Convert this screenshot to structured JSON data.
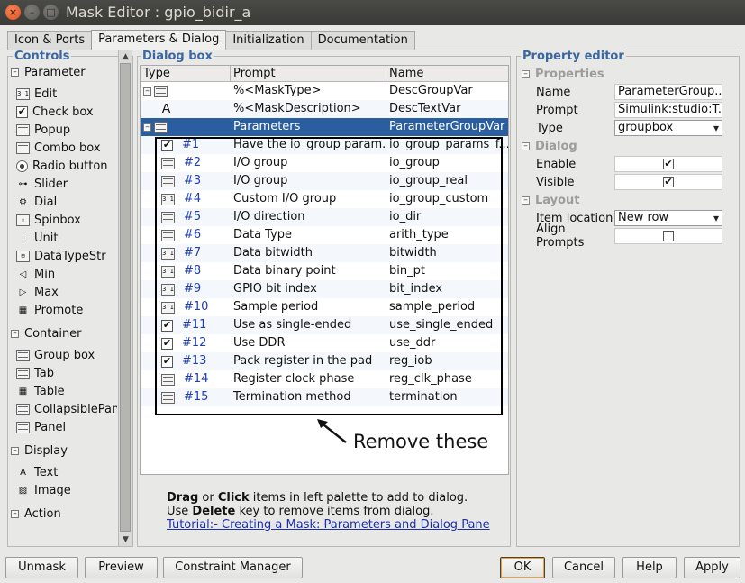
{
  "window": {
    "title": "Mask Editor : gpio_bidir_a"
  },
  "tabs": [
    "Icon & Ports",
    "Parameters & Dialog",
    "Initialization",
    "Documentation"
  ],
  "controls": {
    "title": "Controls",
    "groups": [
      {
        "label": "Parameter",
        "items": [
          {
            "label": "Edit",
            "icon": "edit-icon"
          },
          {
            "label": "Check box",
            "icon": "checkbox-icon"
          },
          {
            "label": "Popup",
            "icon": "popup-icon"
          },
          {
            "label": "Combo box",
            "icon": "combobox-icon"
          },
          {
            "label": "Radio button",
            "icon": "radio-icon"
          },
          {
            "label": "Slider",
            "icon": "slider-icon"
          },
          {
            "label": "Dial",
            "icon": "dial-icon"
          },
          {
            "label": "Spinbox",
            "icon": "spinbox-icon"
          },
          {
            "label": "Unit",
            "icon": "unit-icon"
          },
          {
            "label": "DataTypeStr",
            "icon": "datatype-icon"
          },
          {
            "label": "Min",
            "icon": "min-icon"
          },
          {
            "label": "Max",
            "icon": "max-icon"
          },
          {
            "label": "Promote",
            "icon": "promote-icon"
          }
        ]
      },
      {
        "label": "Container",
        "items": [
          {
            "label": "Group box",
            "icon": "groupbox-icon"
          },
          {
            "label": "Tab",
            "icon": "tab-icon"
          },
          {
            "label": "Table",
            "icon": "table-icon"
          },
          {
            "label": "CollapsiblePanel",
            "icon": "collapsible-icon"
          },
          {
            "label": "Panel",
            "icon": "panel-icon"
          }
        ]
      },
      {
        "label": "Display",
        "items": [
          {
            "label": "Text",
            "icon": "text-icon"
          },
          {
            "label": "Image",
            "icon": "image-icon"
          }
        ]
      },
      {
        "label": "Action",
        "items": []
      }
    ]
  },
  "dialog": {
    "title": "Dialog box",
    "columns": [
      "Type",
      "Prompt",
      "Name"
    ],
    "top_rows": [
      {
        "num": "",
        "prompt": "%<MaskType>",
        "name": "DescGroupVar",
        "kind": "group-root"
      },
      {
        "num": "",
        "prompt": "%<MaskDescription>",
        "name": "DescTextVar",
        "kind": "text"
      },
      {
        "num": "",
        "prompt": "Parameters",
        "name": "ParameterGroupVar",
        "kind": "group-sel"
      }
    ],
    "rows": [
      {
        "num": "#1",
        "prompt": "Have the io_group param...",
        "name": "io_group_params_f...",
        "kind": "checkbox"
      },
      {
        "num": "#2",
        "prompt": "I/O group",
        "name": "io_group",
        "kind": "popup"
      },
      {
        "num": "#3",
        "prompt": "I/O group",
        "name": "io_group_real",
        "kind": "popup"
      },
      {
        "num": "#4",
        "prompt": "Custom I/O group",
        "name": "io_group_custom",
        "kind": "edit"
      },
      {
        "num": "#5",
        "prompt": "I/O direction",
        "name": "io_dir",
        "kind": "popup"
      },
      {
        "num": "#6",
        "prompt": "Data Type",
        "name": "arith_type",
        "kind": "popup"
      },
      {
        "num": "#7",
        "prompt": "Data bitwidth",
        "name": "bitwidth",
        "kind": "edit"
      },
      {
        "num": "#8",
        "prompt": "Data binary point",
        "name": "bin_pt",
        "kind": "edit"
      },
      {
        "num": "#9",
        "prompt": "GPIO bit index",
        "name": "bit_index",
        "kind": "edit"
      },
      {
        "num": "#10",
        "prompt": "Sample period",
        "name": "sample_period",
        "kind": "edit"
      },
      {
        "num": "#11",
        "prompt": "Use as single-ended",
        "name": "use_single_ended",
        "kind": "checkbox"
      },
      {
        "num": "#12",
        "prompt": "Use DDR",
        "name": "use_ddr",
        "kind": "checkbox"
      },
      {
        "num": "#13",
        "prompt": "Pack register in the pad",
        "name": "reg_iob",
        "kind": "checkbox"
      },
      {
        "num": "#14",
        "prompt": "Register clock phase",
        "name": "reg_clk_phase",
        "kind": "popup"
      },
      {
        "num": "#15",
        "prompt": "Termination method",
        "name": "termination",
        "kind": "popup"
      }
    ],
    "annotation": "Remove these",
    "help": {
      "line1_bold1": "Drag",
      "line1_mid": " or ",
      "line1_bold2": "Click",
      "line1_rest": " items in left palette to add to dialog.",
      "line2_pre": "Use ",
      "line2_bold": "Delete",
      "line2_rest": " key to remove items from dialog.",
      "link": "Tutorial:- Creating a Mask: Parameters and Dialog Pane"
    }
  },
  "property_editor": {
    "title": "Property editor",
    "groups": [
      {
        "label": "Properties",
        "rows": [
          {
            "label": "Name",
            "value": "ParameterGroup...",
            "kind": "text"
          },
          {
            "label": "Prompt",
            "value": "Simulink:studio:T...",
            "kind": "text"
          },
          {
            "label": "Type",
            "value": "groupbox",
            "kind": "combo"
          }
        ]
      },
      {
        "label": "Dialog",
        "rows": [
          {
            "label": "Enable",
            "value": "✔",
            "kind": "check"
          },
          {
            "label": "Visible",
            "value": "✔",
            "kind": "check"
          }
        ]
      },
      {
        "label": "Layout",
        "rows": [
          {
            "label": "Item location",
            "value": "New row",
            "kind": "combo"
          },
          {
            "label": "Align Prompts",
            "value": "",
            "kind": "check"
          }
        ]
      }
    ]
  },
  "buttons": {
    "unmask": "Unmask",
    "preview": "Preview",
    "constraint": "Constraint Manager",
    "ok": "OK",
    "cancel": "Cancel",
    "help": "Help",
    "apply": "Apply"
  }
}
